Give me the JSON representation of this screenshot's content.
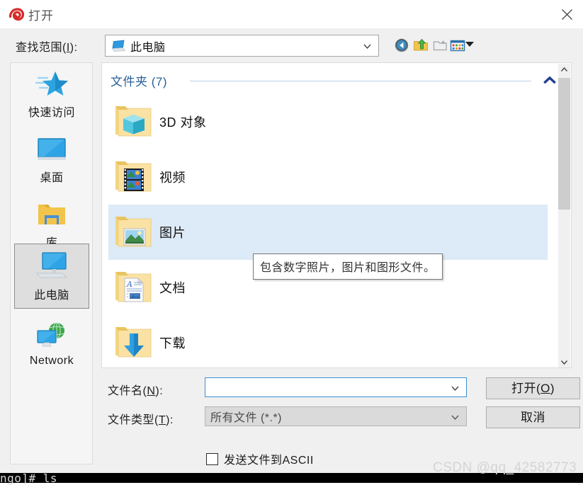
{
  "window": {
    "title": "打开",
    "title_icon": "snail-logo-icon",
    "close_icon": "close-icon"
  },
  "lookin": {
    "label_prefix": "查找范围(",
    "label_key": "I",
    "label_suffix": "):",
    "current_path": "此电脑",
    "path_icon": "computer-icon",
    "dropdown_icon": "chevron-down-icon"
  },
  "toolbar": {
    "buttons": [
      {
        "name": "back-button",
        "icon": "back-arrow-icon",
        "title": "后退"
      },
      {
        "name": "up-button",
        "icon": "up-folder-icon",
        "title": "向上一级"
      },
      {
        "name": "new-folder-button",
        "icon": "new-folder-icon",
        "title": "新建文件夹"
      },
      {
        "name": "views-button",
        "icon": "view-mode-icon",
        "title": "查看"
      }
    ],
    "views_dropdown_icon": "triangle-down-icon"
  },
  "places_bar": {
    "items": [
      {
        "label": "快速访问",
        "icon": "star-icon",
        "selected": false
      },
      {
        "label": "桌面",
        "icon": "monitor-icon",
        "selected": false
      },
      {
        "label": "库",
        "icon": "library-folder-icon",
        "selected": false
      },
      {
        "label": "此电脑",
        "icon": "this-pc-icon",
        "selected": true
      },
      {
        "label": "Network",
        "icon": "network-globe-icon",
        "selected": false
      }
    ]
  },
  "file_list": {
    "group_header": "文件夹 (7)",
    "collapse_icon": "chevron-up-icon",
    "rows": [
      {
        "label": "3D 对象",
        "icon": "folder-3d-object-icon",
        "selected": false
      },
      {
        "label": "视频",
        "icon": "folder-videos-icon",
        "selected": false
      },
      {
        "label": "图片",
        "icon": "folder-pictures-icon",
        "selected": true
      },
      {
        "label": "文档",
        "icon": "folder-documents-icon",
        "selected": false
      },
      {
        "label": "下载",
        "icon": "folder-downloads-icon",
        "selected": false
      }
    ],
    "scrollbar": {
      "up_icon": "scroll-up-icon",
      "down_icon": "scroll-down-icon"
    }
  },
  "tooltip": {
    "text": "包含数字照片，图片和图形文件。"
  },
  "form": {
    "filename_label_prefix": "文件名(",
    "filename_label_key": "N",
    "filename_label_suffix": "):",
    "filename_value": "",
    "filename_placeholder": "",
    "filetype_label_prefix": "文件类型(",
    "filetype_label_key": "T",
    "filetype_label_suffix": "):",
    "filetype_value": "所有文件 (*.*)",
    "filetype_options": [
      "所有文件 (*.*)"
    ],
    "dropdown_icon": "chevron-down-icon",
    "ascii_checkbox_label": "发送文件到ASCII",
    "ascii_checkbox_checked": false
  },
  "buttons": {
    "open_prefix": "打开(",
    "open_key": "O",
    "open_suffix": ")",
    "cancel_label": "取消"
  },
  "watermark": {
    "text": "CSDN @qq_42582773"
  },
  "terminal": {
    "text": "ngo]# ls"
  },
  "colors": {
    "selection_blue": "#ddeaf7",
    "group_header_blue": "#2a6099",
    "focus_border_blue": "#3b8fd3",
    "dialog_bg": "#f0f0f0",
    "accent_red": "#cc2222"
  }
}
